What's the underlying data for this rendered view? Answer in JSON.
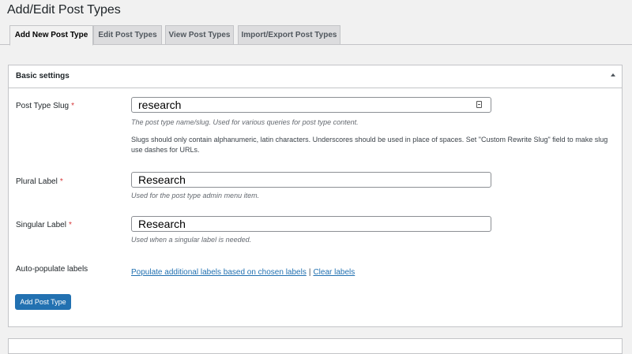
{
  "page": {
    "title": "Add/Edit Post Types"
  },
  "tabs": [
    {
      "label": "Add New Post Type",
      "active": true
    },
    {
      "label": "Edit Post Types",
      "active": false
    },
    {
      "label": "View Post Types",
      "active": false
    },
    {
      "label": "Import/Export Post Types",
      "active": false
    }
  ],
  "panel": {
    "title": "Basic settings",
    "slug": {
      "label": "Post Type Slug",
      "required": "*",
      "value": "research",
      "help": "The post type name/slug. Used for various queries for post type content.",
      "note": "Slugs should only contain alphanumeric, latin characters. Underscores should be used in place of spaces. Set \"Custom Rewrite Slug\" field to make slug use dashes for URLs."
    },
    "plural": {
      "label": "Plural Label",
      "required": "*",
      "value": "Research",
      "help": "Used for the post type admin menu item."
    },
    "singular": {
      "label": "Singular Label",
      "required": "*",
      "value": "Research",
      "help": "Used when a singular label is needed."
    },
    "autopopulate": {
      "label": "Auto-populate labels",
      "populate_link": "Populate additional labels based on chosen labels",
      "separator": "|",
      "clear_link": "Clear labels"
    },
    "submit_label": "Add Post Type"
  }
}
